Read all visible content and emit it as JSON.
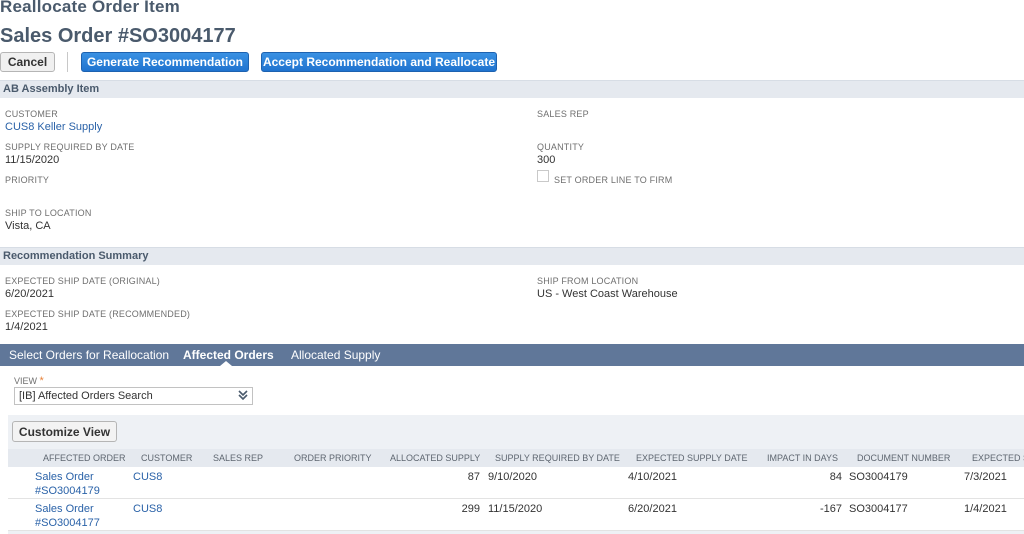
{
  "header": {
    "page_title": "Reallocate Order Item",
    "record_title": "Sales Order #SO3004177"
  },
  "toolbar": {
    "cancel_label": "Cancel",
    "generate_label": "Generate Recommendation",
    "accept_label": "Accept Recommendation and Reallocate"
  },
  "item_section": {
    "title": "AB Assembly Item",
    "customer_label": "CUSTOMER",
    "customer_value": "CUS8 Keller Supply",
    "sales_rep_label": "SALES REP",
    "supply_date_label": "SUPPLY REQUIRED BY DATE",
    "supply_date_value": "11/15/2020",
    "quantity_label": "QUANTITY",
    "quantity_value": "300",
    "priority_label": "PRIORITY",
    "firm_label": "SET ORDER LINE TO FIRM",
    "ship_to_label": "SHIP TO LOCATION",
    "ship_to_value": "Vista, CA"
  },
  "summary_section": {
    "title": "Recommendation Summary",
    "orig_label": "EXPECTED SHIP DATE (ORIGINAL)",
    "orig_value": "6/20/2021",
    "rec_label": "EXPECTED SHIP DATE (RECOMMENDED)",
    "rec_value": "1/4/2021",
    "ship_from_label": "SHIP FROM LOCATION",
    "ship_from_value": "US - West Coast Warehouse"
  },
  "tabs": [
    {
      "label": "Select Orders for Reallocation",
      "active": false
    },
    {
      "label": "Affected Orders",
      "active": true
    },
    {
      "label": "Allocated Supply",
      "active": false
    }
  ],
  "view": {
    "label": "VIEW",
    "required_mark": "*",
    "selected": "[IB] Affected Orders Search",
    "dropdown_icon": "double-chevron-down-icon"
  },
  "list": {
    "customize_label": "Customize View",
    "columns": [
      "AFFECTED ORDER",
      "CUSTOMER",
      "SALES REP",
      "ORDER PRIORITY",
      "ALLOCATED SUPPLY",
      "SUPPLY REQUIRED BY DATE",
      "EXPECTED SUPPLY DATE",
      "IMPACT IN DAYS",
      "DOCUMENT NUMBER",
      "EXPECTED SU"
    ],
    "rows": [
      {
        "order_line1": "Sales Order",
        "order_line2": "#SO3004179",
        "customer": "CUS8",
        "sales_rep": "",
        "priority": "",
        "allocated": "87",
        "required_date": "9/10/2020",
        "expected_supply": "4/10/2021",
        "impact": "84",
        "doc_number": "SO3004179",
        "expected_ship": "7/3/2021"
      },
      {
        "order_line1": "Sales Order",
        "order_line2": "#SO3004177",
        "customer": "CUS8",
        "sales_rep": "",
        "priority": "",
        "allocated": "299",
        "required_date": "11/15/2020",
        "expected_supply": "6/20/2021",
        "impact": "-167",
        "doc_number": "SO3004177",
        "expected_ship": "1/4/2021"
      }
    ]
  },
  "colors": {
    "primary_button": "#2a7fd8",
    "tab_bar": "#607799",
    "link": "#2a62a8",
    "section_bar": "#e5e9ef"
  }
}
